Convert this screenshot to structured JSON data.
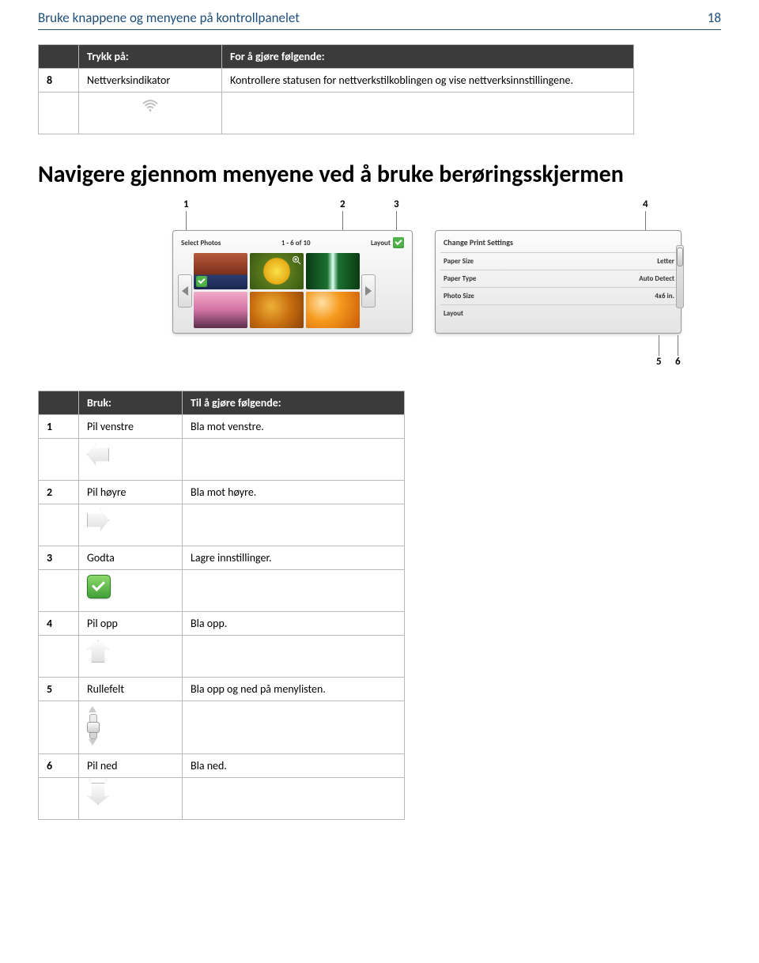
{
  "header": {
    "title": "Bruke knappene og menyene på kontrollpanelet",
    "page": "18"
  },
  "table1": {
    "h1": "",
    "h2": "Trykk på:",
    "h3": "For å gjøre følgende:",
    "num": "8",
    "name": "Nettverksindikator",
    "desc": "Kontrollere statusen for nettverkstilkoblingen og vise nettverksinnstillingene."
  },
  "section_heading": "Navigere gjennom menyene ved å bruke berøringsskjermen",
  "callouts": {
    "c1": "1",
    "c2": "2",
    "c3": "3",
    "c4": "4",
    "c5": "5",
    "c6": "6"
  },
  "screen": {
    "left": {
      "select": "Select Photos",
      "count": "1 - 6 of 10",
      "layout": "Layout"
    },
    "right": {
      "title": "Change Print Settings",
      "rows": [
        {
          "k": "Paper Size",
          "v": "Letter"
        },
        {
          "k": "Paper Type",
          "v": "Auto Detect"
        },
        {
          "k": "Photo Size",
          "v": "4x6 in."
        },
        {
          "k": "Layout",
          "v": ""
        }
      ]
    }
  },
  "table2": {
    "h1": "",
    "h2": "Bruk:",
    "h3": "Til å gjøre følgende:",
    "rows": [
      {
        "n": "1",
        "name": "Pil venstre",
        "d": "Bla mot venstre.",
        "icon": "arrow-left"
      },
      {
        "n": "2",
        "name": "Pil høyre",
        "d": "Bla mot høyre.",
        "icon": "arrow-right"
      },
      {
        "n": "3",
        "name": "Godta",
        "d": "Lagre innstillinger.",
        "icon": "accept"
      },
      {
        "n": "4",
        "name": "Pil opp",
        "d": "Bla opp.",
        "icon": "arrow-up"
      },
      {
        "n": "5",
        "name": "Rullefelt",
        "d": "Bla opp og ned på menylisten.",
        "icon": "scroll"
      },
      {
        "n": "6",
        "name": "Pil ned",
        "d": "Bla ned.",
        "icon": "arrow-down"
      }
    ]
  }
}
